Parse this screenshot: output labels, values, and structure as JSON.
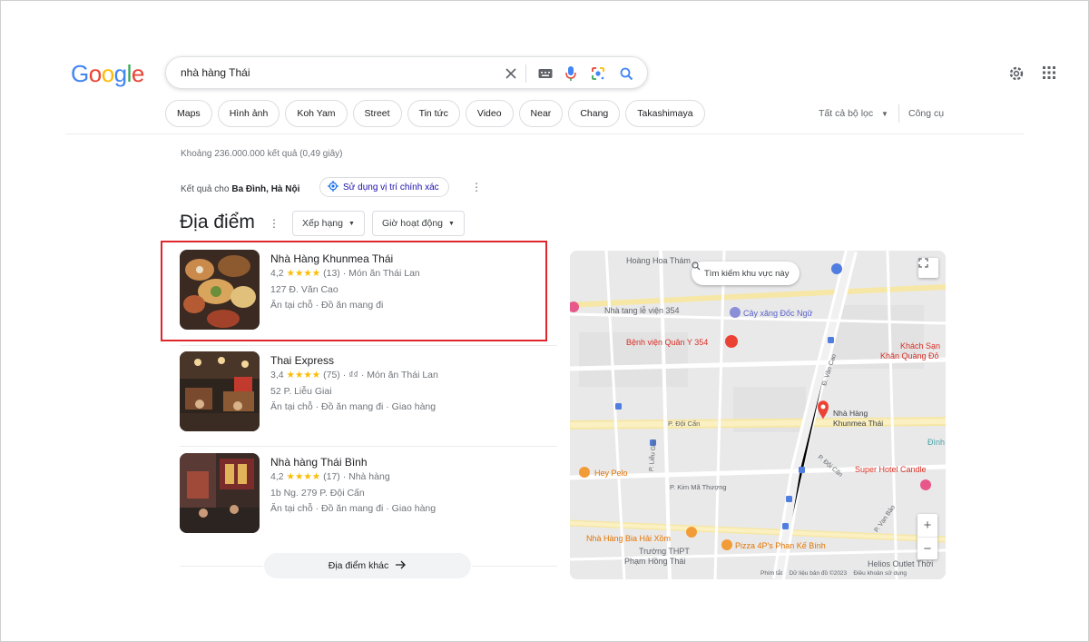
{
  "search": {
    "query": "nhà hàng Thái"
  },
  "chips": [
    "Maps",
    "Hình ảnh",
    "Koh Yam",
    "Street",
    "Tin tức",
    "Video",
    "Near",
    "Chang",
    "Takashimaya"
  ],
  "tools": {
    "all_filters": "Tất cả bộ lọc",
    "tools": "Công cụ"
  },
  "stats": "Khoảng 236.000.000 kết quả (0,49 giây)",
  "location": {
    "prefix": "Kết quả cho",
    "place": "Ba Đình, Hà Nội",
    "precise_button": "Sử dụng vị trí chính xác"
  },
  "places": {
    "title": "Địa điểm",
    "filter_rank": "Xếp hạng",
    "filter_hours": "Giờ hoạt động",
    "more_button": "Địa điểm khác"
  },
  "listings": [
    {
      "name": "Nhà Hàng Khunmea Thái",
      "rating": "4,2",
      "stars": "★★★★",
      "reviews": "(13)",
      "category": "· Món ăn Thái Lan",
      "address": "127 Đ. Văn Cao",
      "services": "Ăn tại chỗ · Đồ ăn mang đi"
    },
    {
      "name": "Thai Express",
      "rating": "3,4",
      "stars": "★★★★",
      "reviews": "(75)",
      "category": "· ₫₫ · Món ăn Thái Lan",
      "address": "52 P. Liễu Giai",
      "services": "Ăn tại chỗ · Đồ ăn mang đi · Giao hàng"
    },
    {
      "name": "Nhà hàng Thái Bình",
      "rating": "4,2",
      "stars": "★★★★",
      "reviews": "(17)",
      "category": "· Nhà hàng",
      "address": "1b Ng. 279 P. Đội Cấn",
      "services": "Ăn tại chỗ · Đồ ăn mang đi · Giao hàng"
    }
  ],
  "map": {
    "search_area": "Tìm kiếm khu vực này",
    "labels": {
      "hoang_hoa_tham": "Hoàng Hoa Thám",
      "nha_tang_le": "Nhà tang lễ viện 354",
      "cay_xang": "Cây xăng Đốc Ngữ",
      "benh_vien": "Bệnh viện Quân Y 354",
      "khach_san": "Khách Sạn",
      "khan_quang_do": "Khăn Quàng Đỏ",
      "van_cao_road": "Đ. Văn Cao",
      "doi_can_1": "P. Đội Cấn",
      "lieu_giai": "P. Liễu Giai",
      "doi_can_2": "P. Đội Cấn",
      "nha_hang_pin": "Nhà Hàng",
      "nha_hang_pin2": "Khunmea Thái",
      "hey_pelo": "Hey Pelo",
      "kim_ma": "P. Kim Mã Thượng",
      "super_hotel": "Super Hotel Candle",
      "dinh": "Đình",
      "van_bao": "P. Vạn Bảo",
      "bia_hoi": "Nhà Hàng Bia Hải Xồm",
      "pizza": "Pizza 4P's Phan Kế Bính",
      "truong": "Trường THPT",
      "pham_hong_thai": "Phạm Hồng Thái",
      "helios": "Helios Outlet Thời"
    },
    "footer_shortcuts": "Phím tắt",
    "footer_data": "Dữ liệu bản đồ ©2023",
    "footer_terms": "Điều khoản sử dụng"
  },
  "colors": {
    "highlight": "#e0262b",
    "star": "#fbbc04",
    "link": "#1a0dab",
    "map_pin": "#ea4335"
  }
}
